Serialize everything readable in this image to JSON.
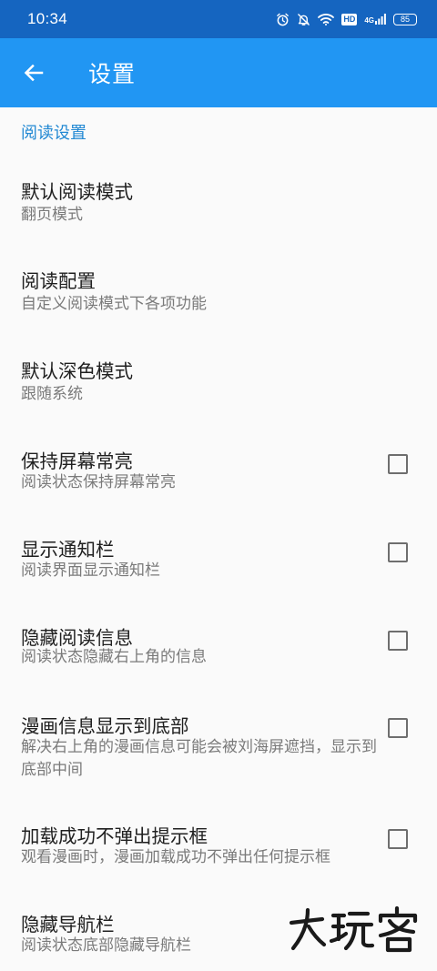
{
  "status_bar": {
    "time": "10:34",
    "hd_label": "HD",
    "network_label": "4G",
    "battery_level": "85",
    "icons": [
      "alarm-icon",
      "mute-icon",
      "wifi-icon",
      "hd-icon",
      "signal-icon",
      "battery-icon"
    ]
  },
  "app_bar": {
    "title": "设置",
    "back_icon": "arrow-back-icon"
  },
  "section": {
    "title": "阅读设置"
  },
  "preferences": [
    {
      "title": "默认阅读模式",
      "summary": "翻页模式"
    },
    {
      "title": "阅读配置",
      "summary": "自定义阅读模式下各项功能"
    },
    {
      "title": "默认深色模式",
      "summary": "跟随系统"
    },
    {
      "title": "保持屏幕常亮",
      "summary": "阅读状态保持屏幕常亮",
      "checked": false
    },
    {
      "title": "显示通知栏",
      "summary": "阅读界面显示通知栏",
      "checked": false
    },
    {
      "title": "隐藏阅读信息",
      "summary": "阅读状态隐藏右上角的信息",
      "checked": false
    },
    {
      "title": "漫画信息显示到底部",
      "summary": "解决右上角的漫画信息可能会被刘海屏遮挡，显示到底部中间",
      "checked": false
    },
    {
      "title": "加载成功不弹出提示框",
      "summary": "观看漫画时，漫画加载成功不弹出任何提示框",
      "checked": false
    },
    {
      "title": "隐藏导航栏",
      "summary": "阅读状态底部隐藏导航栏"
    }
  ],
  "watermark": {
    "text": "大玩客"
  },
  "colors": {
    "status_bar": "#1565c0",
    "app_bar": "#2196f3",
    "accent": "#2188d3",
    "background": "#fafafa"
  }
}
